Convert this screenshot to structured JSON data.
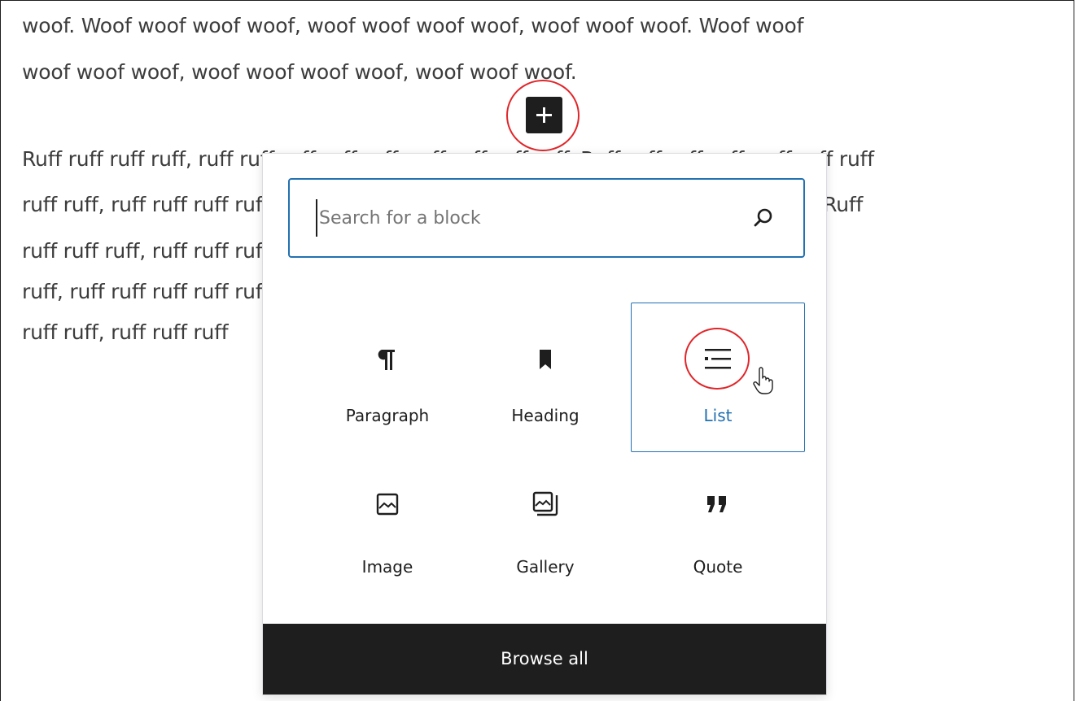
{
  "editor": {
    "paragraph1": [
      "woof. Woof woof woof woof, woof woof woof woof, woof woof woof. Woof woof",
      "woof woof woof, woof woof woof woof, woof woof woof."
    ],
    "paragraph2": [
      "Ruff ruff ruff ruff, ruff ruff ruff ruff ruff, ruff ruff ruff ruff. Ruff ruff ruff ruff, ruff ruff ruff",
      "ruff ruff, ruff ruff ruff ruff ruff, ruff ruff ruff ruff ruff ruff ruff ruff ruff ruff ruff ruff. Ruff",
      "ruff ruff ruff, ruff ruff ruff ruff ruff ruff ruff ruff ruff ruff ruff ruff, ruff ruff ruff ruff",
      "ruff, ruff ruff ruff ruff ruff ruff ruff ruff ruff ruff ruff ruff ruff ruff ruff ruff. Ruff ruff",
      "ruff ruff, ruff ruff ruff"
    ],
    "inserter_toggle_icon": "plus-icon"
  },
  "inserter": {
    "search_placeholder": "Search for a block",
    "search_icon": "search-icon",
    "blocks": [
      {
        "label": "Paragraph",
        "icon": "paragraph-icon"
      },
      {
        "label": "Heading",
        "icon": "heading-bookmark-icon"
      },
      {
        "label": "List",
        "icon": "list-icon",
        "selected": true
      },
      {
        "label": "Image",
        "icon": "image-icon"
      },
      {
        "label": "Gallery",
        "icon": "gallery-icon"
      },
      {
        "label": "Quote",
        "icon": "quote-icon"
      }
    ],
    "browse_all_label": "Browse all"
  },
  "colors": {
    "accent": "#2271b1",
    "highlight": "#e0262a",
    "dark": "#1e1e1e",
    "body_text": "#3c3c3c"
  }
}
